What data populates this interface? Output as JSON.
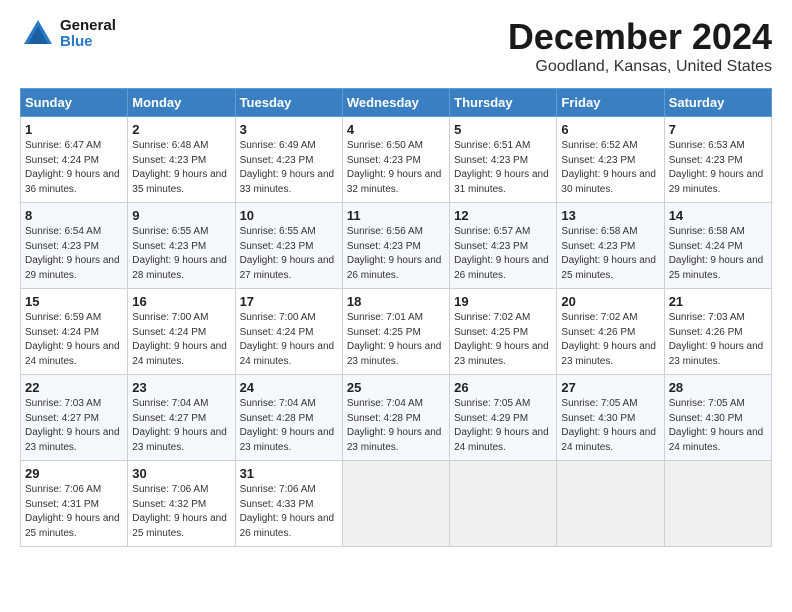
{
  "header": {
    "logo_general": "General",
    "logo_blue": "Blue",
    "month_title": "December 2024",
    "location": "Goodland, Kansas, United States"
  },
  "weekdays": [
    "Sunday",
    "Monday",
    "Tuesday",
    "Wednesday",
    "Thursday",
    "Friday",
    "Saturday"
  ],
  "weeks": [
    [
      {
        "day": "1",
        "sunrise": "6:47 AM",
        "sunset": "4:24 PM",
        "daylight": "9 hours and 36 minutes."
      },
      {
        "day": "2",
        "sunrise": "6:48 AM",
        "sunset": "4:23 PM",
        "daylight": "9 hours and 35 minutes."
      },
      {
        "day": "3",
        "sunrise": "6:49 AM",
        "sunset": "4:23 PM",
        "daylight": "9 hours and 33 minutes."
      },
      {
        "day": "4",
        "sunrise": "6:50 AM",
        "sunset": "4:23 PM",
        "daylight": "9 hours and 32 minutes."
      },
      {
        "day": "5",
        "sunrise": "6:51 AM",
        "sunset": "4:23 PM",
        "daylight": "9 hours and 31 minutes."
      },
      {
        "day": "6",
        "sunrise": "6:52 AM",
        "sunset": "4:23 PM",
        "daylight": "9 hours and 30 minutes."
      },
      {
        "day": "7",
        "sunrise": "6:53 AM",
        "sunset": "4:23 PM",
        "daylight": "9 hours and 29 minutes."
      }
    ],
    [
      {
        "day": "8",
        "sunrise": "6:54 AM",
        "sunset": "4:23 PM",
        "daylight": "9 hours and 29 minutes."
      },
      {
        "day": "9",
        "sunrise": "6:55 AM",
        "sunset": "4:23 PM",
        "daylight": "9 hours and 28 minutes."
      },
      {
        "day": "10",
        "sunrise": "6:55 AM",
        "sunset": "4:23 PM",
        "daylight": "9 hours and 27 minutes."
      },
      {
        "day": "11",
        "sunrise": "6:56 AM",
        "sunset": "4:23 PM",
        "daylight": "9 hours and 26 minutes."
      },
      {
        "day": "12",
        "sunrise": "6:57 AM",
        "sunset": "4:23 PM",
        "daylight": "9 hours and 26 minutes."
      },
      {
        "day": "13",
        "sunrise": "6:58 AM",
        "sunset": "4:23 PM",
        "daylight": "9 hours and 25 minutes."
      },
      {
        "day": "14",
        "sunrise": "6:58 AM",
        "sunset": "4:24 PM",
        "daylight": "9 hours and 25 minutes."
      }
    ],
    [
      {
        "day": "15",
        "sunrise": "6:59 AM",
        "sunset": "4:24 PM",
        "daylight": "9 hours and 24 minutes."
      },
      {
        "day": "16",
        "sunrise": "7:00 AM",
        "sunset": "4:24 PM",
        "daylight": "9 hours and 24 minutes."
      },
      {
        "day": "17",
        "sunrise": "7:00 AM",
        "sunset": "4:24 PM",
        "daylight": "9 hours and 24 minutes."
      },
      {
        "day": "18",
        "sunrise": "7:01 AM",
        "sunset": "4:25 PM",
        "daylight": "9 hours and 23 minutes."
      },
      {
        "day": "19",
        "sunrise": "7:02 AM",
        "sunset": "4:25 PM",
        "daylight": "9 hours and 23 minutes."
      },
      {
        "day": "20",
        "sunrise": "7:02 AM",
        "sunset": "4:26 PM",
        "daylight": "9 hours and 23 minutes."
      },
      {
        "day": "21",
        "sunrise": "7:03 AM",
        "sunset": "4:26 PM",
        "daylight": "9 hours and 23 minutes."
      }
    ],
    [
      {
        "day": "22",
        "sunrise": "7:03 AM",
        "sunset": "4:27 PM",
        "daylight": "9 hours and 23 minutes."
      },
      {
        "day": "23",
        "sunrise": "7:04 AM",
        "sunset": "4:27 PM",
        "daylight": "9 hours and 23 minutes."
      },
      {
        "day": "24",
        "sunrise": "7:04 AM",
        "sunset": "4:28 PM",
        "daylight": "9 hours and 23 minutes."
      },
      {
        "day": "25",
        "sunrise": "7:04 AM",
        "sunset": "4:28 PM",
        "daylight": "9 hours and 23 minutes."
      },
      {
        "day": "26",
        "sunrise": "7:05 AM",
        "sunset": "4:29 PM",
        "daylight": "9 hours and 24 minutes."
      },
      {
        "day": "27",
        "sunrise": "7:05 AM",
        "sunset": "4:30 PM",
        "daylight": "9 hours and 24 minutes."
      },
      {
        "day": "28",
        "sunrise": "7:05 AM",
        "sunset": "4:30 PM",
        "daylight": "9 hours and 24 minutes."
      }
    ],
    [
      {
        "day": "29",
        "sunrise": "7:06 AM",
        "sunset": "4:31 PM",
        "daylight": "9 hours and 25 minutes."
      },
      {
        "day": "30",
        "sunrise": "7:06 AM",
        "sunset": "4:32 PM",
        "daylight": "9 hours and 25 minutes."
      },
      {
        "day": "31",
        "sunrise": "7:06 AM",
        "sunset": "4:33 PM",
        "daylight": "9 hours and 26 minutes."
      },
      null,
      null,
      null,
      null
    ]
  ]
}
